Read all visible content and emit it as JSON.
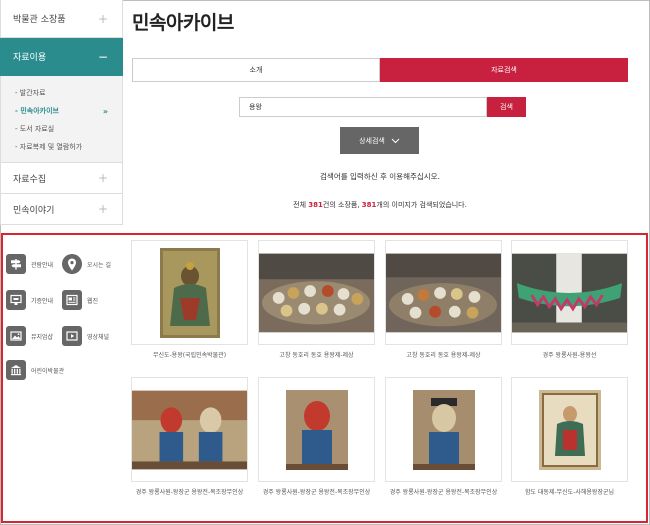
{
  "sidebar": {
    "items": [
      {
        "label": "박물관 소장품",
        "sign": "+"
      },
      {
        "label": "자료이용",
        "sign": "−"
      },
      {
        "label": "자료수집",
        "sign": "+"
      },
      {
        "label": "민속이야기",
        "sign": "+"
      }
    ],
    "sub_items": [
      {
        "label": "- 발간자료"
      },
      {
        "label": "- 민속아카이브",
        "arrow": "»"
      },
      {
        "label": "- 도서 자료실"
      },
      {
        "label": "- 자료복제 및 열람허가"
      }
    ]
  },
  "main": {
    "title": "민속아카이브",
    "tabs": [
      {
        "label": "소개"
      },
      {
        "label": "자료검색"
      }
    ],
    "search": {
      "value": "용왕",
      "button": "검색"
    },
    "detail_button": "상세검색",
    "notice": "검색어를 입력하신 후 이용해주십시오.",
    "result": {
      "prefix": "전체 ",
      "count_items": "381",
      "mid": "건의 소장품, ",
      "count_images": "381",
      "suffix": "개의 이미지가 검색되었습니다."
    }
  },
  "quick_links": [
    {
      "label": "관람안내",
      "icon": "signpost-icon"
    },
    {
      "label": "오시는 길",
      "icon": "location-pin-icon"
    },
    {
      "label": "기증안내",
      "icon": "donation-icon"
    },
    {
      "label": "웹진",
      "icon": "webzine-icon"
    },
    {
      "label": "뮤지엄샵",
      "icon": "shop-icon"
    },
    {
      "label": "영상채널",
      "icon": "video-play-icon"
    },
    {
      "label": "어린이박물관",
      "icon": "building-icon"
    }
  ],
  "cards": [
    {
      "caption": "무신도-용왕(국립민속박물관)"
    },
    {
      "caption": "고창 동호리 동호 용왕제-제상"
    },
    {
      "caption": "고창 동호리 동호 용왕제-제상"
    },
    {
      "caption": "경주 왕룡사원-용왕선"
    },
    {
      "caption": "경주 왕룡사원-왕장군 용왕전-목조장무인상"
    },
    {
      "caption": "경주 왕룡사원-왕장군 용왕전-목조장무인상"
    },
    {
      "caption": "경주 왕룡사원-왕장군 용왕전-목조장무인상"
    },
    {
      "caption": "함도 대동제-무신도-사해용왕장군님"
    }
  ],
  "colors": {
    "accent_teal": "#2b8c8e",
    "accent_red": "#c8203f",
    "highlight": "#d8262f"
  }
}
